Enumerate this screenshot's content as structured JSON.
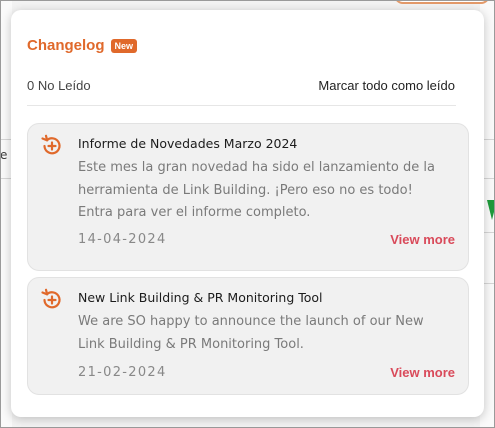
{
  "background": {
    "fragments": [
      "e",
      "e",
      "e"
    ]
  },
  "changelog": {
    "title": "Changelog",
    "badge": "New",
    "unread_count": "0 No Leído",
    "mark_all_label": "Marcar todo como leído",
    "items": [
      {
        "title": "Informe de Novedades Marzo 2024",
        "body": "Este mes la gran novedad ha sido el lanzamiento de la herramienta de Link Building. ¡Pero eso no es todo! Entra para ver el informe completo.",
        "date": "14-04-2024",
        "link_label": "View more",
        "icon": "plus-history-icon"
      },
      {
        "title": "New Link Building & PR Monitoring Tool",
        "body": "We are SO happy to announce the launch of our New Link Building & PR Monitoring Tool.",
        "date": "21-02-2024",
        "link_label": "View more",
        "icon": "plus-history-icon"
      }
    ]
  },
  "colors": {
    "accent": "#e0692b",
    "link": "#d94a5a",
    "card_bg": "#f1f1f1"
  }
}
